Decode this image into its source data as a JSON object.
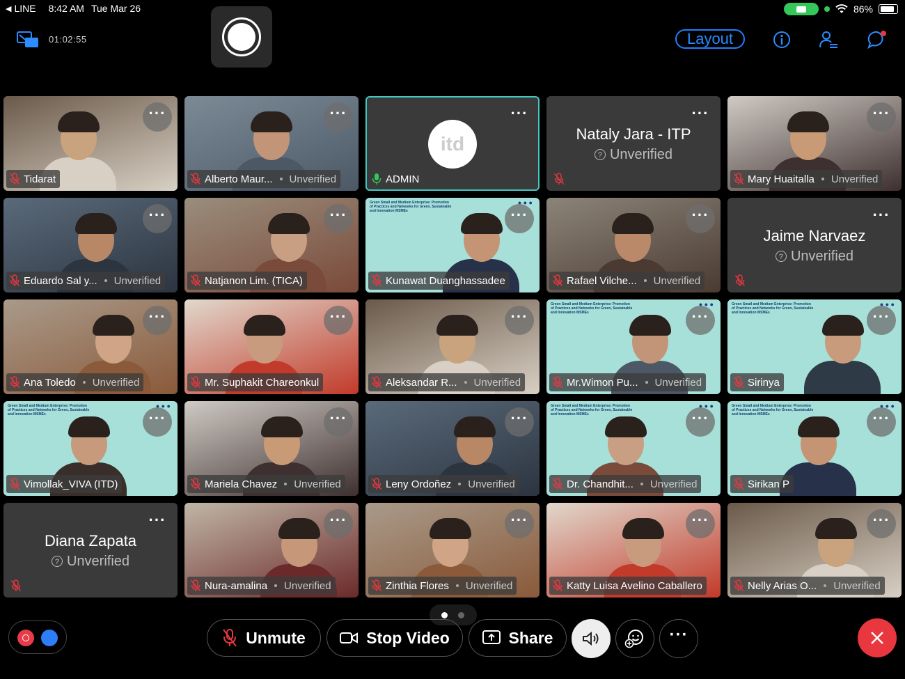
{
  "status_bar": {
    "back_app": "LINE",
    "time": "8:42 AM",
    "date": "Tue Mar 26",
    "battery": "86%"
  },
  "top_bar": {
    "elapsed": "01:02:55",
    "layout_label": "Layout"
  },
  "participants": [
    {
      "name": "Tidarat",
      "status": "",
      "type": "video"
    },
    {
      "name": "Alberto Maur...",
      "status": "Unverified",
      "type": "video"
    },
    {
      "name": "ADMIN",
      "status": "",
      "type": "logo",
      "logo_text": "itd"
    },
    {
      "name": "Nataly Jara - ITP",
      "status": "Unverified",
      "type": "noimg"
    },
    {
      "name": "Mary Huaitalla",
      "status": "Unverified",
      "type": "video"
    },
    {
      "name": "Eduardo Sal y...",
      "status": "Unverified",
      "type": "video"
    },
    {
      "name": "Natjanon Lim. (TICA)",
      "status": "",
      "type": "video"
    },
    {
      "name": "Kunawat Duanghassadee",
      "status": "",
      "type": "banner"
    },
    {
      "name": "Rafael Vilche...",
      "status": "Unverified",
      "type": "video"
    },
    {
      "name": "Jaime Narvaez",
      "status": "Unverified",
      "type": "noimg"
    },
    {
      "name": "Ana Toledo",
      "status": "Unverified",
      "type": "video"
    },
    {
      "name": "Mr. Suphakit Chareonkul",
      "status": "",
      "type": "video"
    },
    {
      "name": "Aleksandar R...",
      "status": "Unverified",
      "type": "video"
    },
    {
      "name": "Mr.Wimon Pu...",
      "status": "Unverified",
      "type": "banner"
    },
    {
      "name": "Sirinya",
      "status": "",
      "type": "banner"
    },
    {
      "name": "Vimollak_VIVA (ITD)",
      "status": "",
      "type": "banner"
    },
    {
      "name": "Mariela Chavez",
      "status": "Unverified",
      "type": "video"
    },
    {
      "name": "Leny Ordoñez",
      "status": "Unverified",
      "type": "video"
    },
    {
      "name": "Dr. Chandhit...",
      "status": "Unverified",
      "type": "banner"
    },
    {
      "name": "Sirikan P",
      "status": "",
      "type": "banner"
    },
    {
      "name": "Diana Zapata",
      "status": "Unverified",
      "type": "noimg"
    },
    {
      "name": "Nura-amalina",
      "status": "Unverified",
      "type": "video"
    },
    {
      "name": "Zinthia Flores",
      "status": "Unverified",
      "type": "video"
    },
    {
      "name": "Katty Luisa Avelino Caballero",
      "status": "",
      "type": "video"
    },
    {
      "name": "Nelly Arias O...",
      "status": "Unverified",
      "type": "video"
    }
  ],
  "banner_text": "Green Small and Medium Enterprise: Promotion of Practices and Networks for Green, Sustainable and Innovation MSMEs",
  "controls": {
    "unmute": "Unmute",
    "stop_video": "Stop Video",
    "share": "Share"
  },
  "colors": {
    "accent": "#1e80ff",
    "end_call": "#e8373f",
    "muted_red": "#e8373f",
    "active_border": "#3ec9c2",
    "banner_bg": "#a7e0d8"
  }
}
